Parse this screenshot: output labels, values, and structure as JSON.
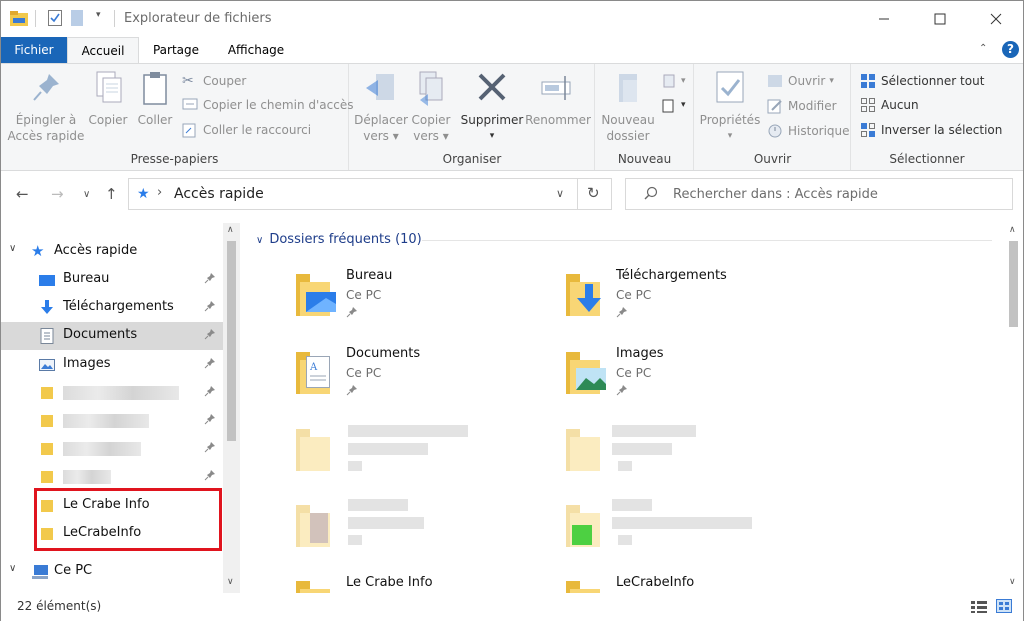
{
  "window": {
    "title": "Explorateur de fichiers"
  },
  "tabs": {
    "file": "Fichier",
    "home": "Accueil",
    "share": "Partage",
    "view": "Affichage"
  },
  "ribbon": {
    "clipboard": {
      "label": "Presse-papiers",
      "pin_line1": "Épingler à",
      "pin_line2": "Accès rapide",
      "copy": "Copier",
      "paste": "Coller",
      "cut": "Couper",
      "copy_path": "Copier le chemin d'accès",
      "paste_shortcut": "Coller le raccourci"
    },
    "organize": {
      "label": "Organiser",
      "move_line1": "Déplacer",
      "move_line2": "vers",
      "copyto_line1": "Copier",
      "copyto_line2": "vers",
      "delete": "Supprimer",
      "rename": "Renommer"
    },
    "new": {
      "label": "Nouveau",
      "folder_line1": "Nouveau",
      "folder_line2": "dossier"
    },
    "open": {
      "label": "Ouvrir",
      "properties": "Propriétés",
      "open": "Ouvrir",
      "edit": "Modifier",
      "history": "Historique"
    },
    "select": {
      "label": "Sélectionner",
      "all": "Sélectionner tout",
      "none": "Aucun",
      "invert": "Inverser la sélection"
    }
  },
  "address": {
    "path": "Accès rapide",
    "search_placeholder": "Rechercher dans : Accès rapide"
  },
  "nav": {
    "quick_access": "Accès rapide",
    "items": [
      {
        "label": "Bureau",
        "pinned": true
      },
      {
        "label": "Téléchargements",
        "pinned": true
      },
      {
        "label": "Documents",
        "pinned": true,
        "selected": true
      },
      {
        "label": "Images",
        "pinned": true
      }
    ],
    "highlighted": [
      "Le Crabe Info",
      "LeCrabeInfo"
    ],
    "this_pc": "Ce PC"
  },
  "content": {
    "group_header": "Dossiers fréquents (10)",
    "tiles": [
      {
        "name": "Bureau",
        "sub": "Ce PC"
      },
      {
        "name": "Téléchargements",
        "sub": "Ce PC"
      },
      {
        "name": "Documents",
        "sub": "Ce PC"
      },
      {
        "name": "Images",
        "sub": "Ce PC"
      },
      {
        "name": "Le Crabe Info",
        "sub": ""
      },
      {
        "name": "LeCrabeInfo",
        "sub": ""
      }
    ]
  },
  "status": {
    "count": "22 élément(s)"
  },
  "colors": {
    "accent": "#1a66b8",
    "highlight_box": "#e0141e",
    "folder": "#f8d675"
  }
}
